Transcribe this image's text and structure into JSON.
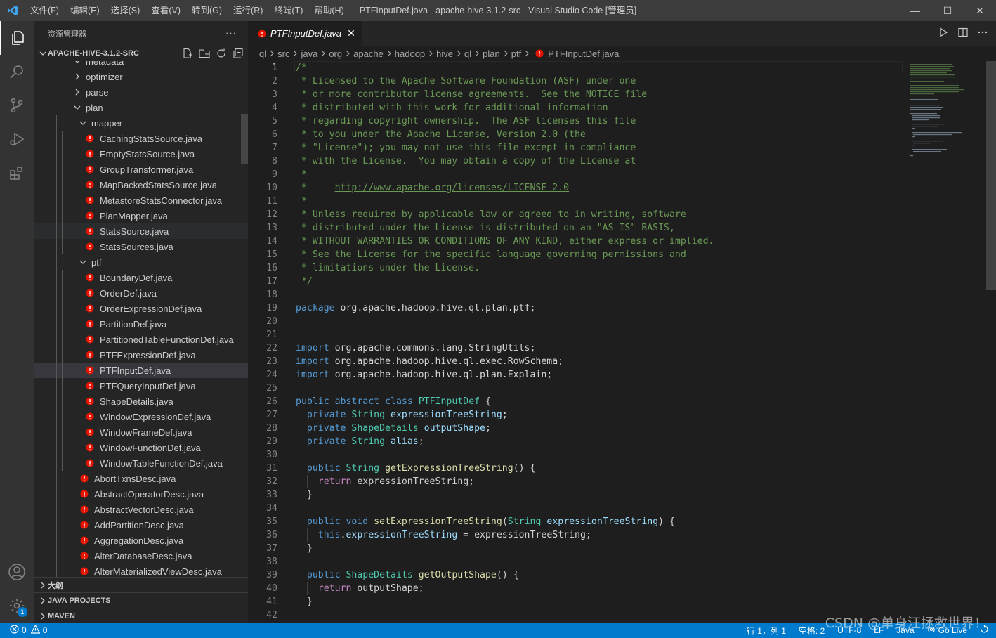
{
  "titlebar": {
    "menus": [
      "文件(F)",
      "编辑(E)",
      "选择(S)",
      "查看(V)",
      "转到(G)",
      "运行(R)",
      "终端(T)",
      "帮助(H)"
    ],
    "window_title": "PTFInputDef.java - apache-hive-3.1.2-src - Visual Studio Code [管理员]",
    "controls": [
      "—",
      "☐",
      "✕"
    ]
  },
  "sidebar": {
    "title": "资源管理器",
    "more": "···",
    "root": "APACHE-HIVE-3.1.2-SRC",
    "tree": [
      {
        "label": "metadata",
        "type": "folder",
        "depth": 1,
        "open": true,
        "partial": true
      },
      {
        "label": "optimizer",
        "type": "folder",
        "depth": 1,
        "open": false
      },
      {
        "label": "parse",
        "type": "folder",
        "depth": 1,
        "open": false
      },
      {
        "label": "plan",
        "type": "folder",
        "depth": 1,
        "open": true
      },
      {
        "label": "mapper",
        "type": "folder",
        "depth": 2,
        "open": true
      },
      {
        "label": "CachingStatsSource.java",
        "type": "file",
        "depth": 3
      },
      {
        "label": "EmptyStatsSource.java",
        "type": "file",
        "depth": 3
      },
      {
        "label": "GroupTransformer.java",
        "type": "file",
        "depth": 3
      },
      {
        "label": "MapBackedStatsSource.java",
        "type": "file",
        "depth": 3
      },
      {
        "label": "MetastoreStatsConnector.java",
        "type": "file",
        "depth": 3
      },
      {
        "label": "PlanMapper.java",
        "type": "file",
        "depth": 3
      },
      {
        "label": "StatsSource.java",
        "type": "file",
        "depth": 3,
        "hover": true
      },
      {
        "label": "StatsSources.java",
        "type": "file",
        "depth": 3
      },
      {
        "label": "ptf",
        "type": "folder",
        "depth": 2,
        "open": true
      },
      {
        "label": "BoundaryDef.java",
        "type": "file",
        "depth": 3
      },
      {
        "label": "OrderDef.java",
        "type": "file",
        "depth": 3
      },
      {
        "label": "OrderExpressionDef.java",
        "type": "file",
        "depth": 3
      },
      {
        "label": "PartitionDef.java",
        "type": "file",
        "depth": 3
      },
      {
        "label": "PartitionedTableFunctionDef.java",
        "type": "file",
        "depth": 3
      },
      {
        "label": "PTFExpressionDef.java",
        "type": "file",
        "depth": 3
      },
      {
        "label": "PTFInputDef.java",
        "type": "file",
        "depth": 3,
        "selected": true
      },
      {
        "label": "PTFQueryInputDef.java",
        "type": "file",
        "depth": 3
      },
      {
        "label": "ShapeDetails.java",
        "type": "file",
        "depth": 3
      },
      {
        "label": "WindowExpressionDef.java",
        "type": "file",
        "depth": 3
      },
      {
        "label": "WindowFrameDef.java",
        "type": "file",
        "depth": 3
      },
      {
        "label": "WindowFunctionDef.java",
        "type": "file",
        "depth": 3
      },
      {
        "label": "WindowTableFunctionDef.java",
        "type": "file",
        "depth": 3
      },
      {
        "label": "AbortTxnsDesc.java",
        "type": "file",
        "depth": 2
      },
      {
        "label": "AbstractOperatorDesc.java",
        "type": "file",
        "depth": 2
      },
      {
        "label": "AbstractVectorDesc.java",
        "type": "file",
        "depth": 2
      },
      {
        "label": "AddPartitionDesc.java",
        "type": "file",
        "depth": 2
      },
      {
        "label": "AggregationDesc.java",
        "type": "file",
        "depth": 2
      },
      {
        "label": "AlterDatabaseDesc.java",
        "type": "file",
        "depth": 2
      },
      {
        "label": "AlterMaterializedViewDesc.java",
        "type": "file",
        "depth": 2
      }
    ],
    "sections": [
      "大纲",
      "JAVA PROJECTS",
      "MAVEN"
    ]
  },
  "editor": {
    "tab_label": "PTFInputDef.java",
    "tab_close": "✕",
    "breadcrumb": [
      "ql",
      "src",
      "java",
      "org",
      "apache",
      "hadoop",
      "hive",
      "ql",
      "plan",
      "ptf",
      "PTFInputDef.java"
    ],
    "current_line": 1,
    "lines": [
      [
        [
          "/*",
          "c-com"
        ]
      ],
      [
        [
          " * Licensed to the Apache Software Foundation (ASF) under one",
          "c-com"
        ]
      ],
      [
        [
          " * or more contributor license agreements.  See the NOTICE file",
          "c-com"
        ]
      ],
      [
        [
          " * distributed with this work for additional information",
          "c-com"
        ]
      ],
      [
        [
          " * regarding copyright ownership.  The ASF licenses this file",
          "c-com"
        ]
      ],
      [
        [
          " * to you under the Apache License, Version 2.0 (the",
          "c-com"
        ]
      ],
      [
        [
          " * \"License\"); you may not use this file except in compliance",
          "c-com"
        ]
      ],
      [
        [
          " * with the License.  You may obtain a copy of the License at",
          "c-com"
        ]
      ],
      [
        [
          " *",
          "c-com"
        ]
      ],
      [
        [
          " *     ",
          "c-com"
        ],
        [
          "http://www.apache.org/licenses/LICENSE-2.0",
          "c-link"
        ]
      ],
      [
        [
          " *",
          "c-com"
        ]
      ],
      [
        [
          " * Unless required by applicable law or agreed to in writing, software",
          "c-com"
        ]
      ],
      [
        [
          " * distributed under the License is distributed on an \"AS IS\" BASIS,",
          "c-com"
        ]
      ],
      [
        [
          " * WITHOUT WARRANTIES OR CONDITIONS OF ANY KIND, either express or implied.",
          "c-com"
        ]
      ],
      [
        [
          " * See the License for the specific language governing permissions and",
          "c-com"
        ]
      ],
      [
        [
          " * limitations under the License.",
          "c-com"
        ]
      ],
      [
        [
          " */",
          "c-com"
        ]
      ],
      [],
      [
        [
          "package",
          "c-kw"
        ],
        [
          " org.apache.hadoop.hive.ql.plan.ptf;",
          ""
        ]
      ],
      [],
      [],
      [
        [
          "import",
          "c-kw"
        ],
        [
          " org.apache.commons.lang.StringUtils;",
          ""
        ]
      ],
      [
        [
          "import",
          "c-kw"
        ],
        [
          " org.apache.hadoop.hive.ql.exec.RowSchema;",
          ""
        ]
      ],
      [
        [
          "import",
          "c-kw"
        ],
        [
          " org.apache.hadoop.hive.ql.plan.Explain;",
          ""
        ]
      ],
      [],
      [
        [
          "public",
          "c-kw"
        ],
        [
          " ",
          ""
        ],
        [
          "abstract",
          "c-kw"
        ],
        [
          " ",
          ""
        ],
        [
          "class",
          "c-kw"
        ],
        [
          " ",
          ""
        ],
        [
          "PTFInputDef",
          "c-type"
        ],
        [
          " {",
          ""
        ]
      ],
      [
        [
          "  ",
          ""
        ],
        [
          "private",
          "c-kw"
        ],
        [
          " ",
          ""
        ],
        [
          "String",
          "c-type"
        ],
        [
          " ",
          ""
        ],
        [
          "expressionTreeString",
          "c-var"
        ],
        [
          ";",
          ""
        ]
      ],
      [
        [
          "  ",
          ""
        ],
        [
          "private",
          "c-kw"
        ],
        [
          " ",
          ""
        ],
        [
          "ShapeDetails",
          "c-type"
        ],
        [
          " ",
          ""
        ],
        [
          "outputShape",
          "c-var"
        ],
        [
          ";",
          ""
        ]
      ],
      [
        [
          "  ",
          ""
        ],
        [
          "private",
          "c-kw"
        ],
        [
          " ",
          ""
        ],
        [
          "String",
          "c-type"
        ],
        [
          " ",
          ""
        ],
        [
          "alias",
          "c-var"
        ],
        [
          ";",
          ""
        ]
      ],
      [],
      [
        [
          "  ",
          ""
        ],
        [
          "public",
          "c-kw"
        ],
        [
          " ",
          ""
        ],
        [
          "String",
          "c-type"
        ],
        [
          " ",
          ""
        ],
        [
          "getExpressionTreeString",
          "c-fn"
        ],
        [
          "() {",
          ""
        ]
      ],
      [
        [
          "    ",
          ""
        ],
        [
          "return",
          "c-ctl"
        ],
        [
          " expressionTreeString;",
          ""
        ]
      ],
      [
        [
          "  }",
          ""
        ]
      ],
      [],
      [
        [
          "  ",
          ""
        ],
        [
          "public",
          "c-kw"
        ],
        [
          " ",
          ""
        ],
        [
          "void",
          "c-kw"
        ],
        [
          " ",
          ""
        ],
        [
          "setExpressionTreeString",
          "c-fn"
        ],
        [
          "(",
          ""
        ],
        [
          "String",
          "c-type"
        ],
        [
          " ",
          ""
        ],
        [
          "expressionTreeString",
          "c-var"
        ],
        [
          ") {",
          ""
        ]
      ],
      [
        [
          "    ",
          ""
        ],
        [
          "this",
          "c-kw"
        ],
        [
          ".",
          ""
        ],
        [
          "expressionTreeString",
          "c-var"
        ],
        [
          " = expressionTreeString;",
          ""
        ]
      ],
      [
        [
          "  }",
          ""
        ]
      ],
      [],
      [
        [
          "  ",
          ""
        ],
        [
          "public",
          "c-kw"
        ],
        [
          " ",
          ""
        ],
        [
          "ShapeDetails",
          "c-type"
        ],
        [
          " ",
          ""
        ],
        [
          "getOutputShape",
          "c-fn"
        ],
        [
          "() {",
          ""
        ]
      ],
      [
        [
          "    ",
          ""
        ],
        [
          "return",
          "c-ctl"
        ],
        [
          " outputShape;",
          ""
        ]
      ],
      [
        [
          "  }",
          ""
        ]
      ],
      []
    ]
  },
  "statusbar": {
    "errors": "0",
    "warnings": "0",
    "position": "行 1，列 1",
    "spaces": "空格: 2",
    "encoding": "UTF-8",
    "eol": "LF",
    "language": "Java",
    "golive": "Go Live"
  },
  "watermark": "CSDN @单身汪拯救世界！",
  "colors": {
    "accent": "#007acc",
    "java_icon": "#e51400",
    "comment": "#6a9955",
    "keyword": "#569cd6",
    "type": "#4ec9b0"
  }
}
